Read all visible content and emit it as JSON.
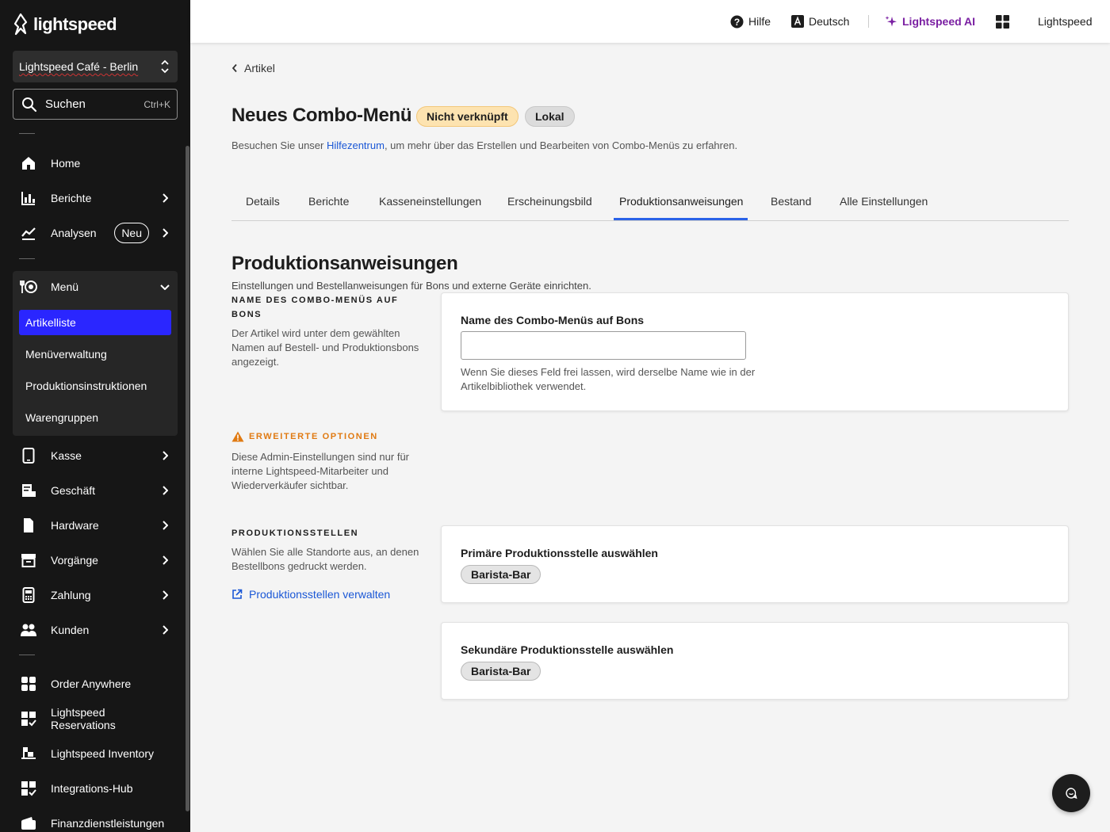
{
  "sidebar": {
    "brand": "lightspeed",
    "store": "Lightspeed Café - Berlin",
    "search": {
      "label": "Suchen",
      "shortcut": "Ctrl+K"
    },
    "nav": {
      "home": "Home",
      "berichte": "Berichte",
      "analysen": "Analysen",
      "analysen_badge": "Neu",
      "menu": "Menü",
      "kasse": "Kasse",
      "geschaeft": "Geschäft",
      "hardware": "Hardware",
      "vorgaenge": "Vorgänge",
      "zahlung": "Zahlung",
      "kunden": "Kunden",
      "order_anywhere": "Order Anywhere",
      "reservations": "Lightspeed Reservations",
      "inventory": "Lightspeed Inventory",
      "integrations": "Integrations-Hub",
      "finanz": "Finanzdienstleistungen"
    },
    "menu_sub": {
      "artikelliste": "Artikelliste",
      "menueverwaltung": "Menüverwaltung",
      "produktionsinstruktionen": "Produktionsinstruktionen",
      "warengruppen": "Warengruppen"
    },
    "active_color": "#2a26ff"
  },
  "topbar": {
    "help": "Hilfe",
    "language": "Deutsch",
    "ai": "Lightspeed AI",
    "ai_color": "#7a1fa2",
    "account": "Lightspeed"
  },
  "page": {
    "back": "Artikel",
    "title": "Neues Combo-Menü",
    "badge_warn": "Nicht verknüpft",
    "badge_local": "Lokal",
    "help_prefix": "Besuchen Sie unser ",
    "help_link": "Hilfezentrum",
    "help_suffix": ", um mehr über das Erstellen und Bearbeiten von Combo-Menüs zu erfahren."
  },
  "tabs": {
    "details": "Details",
    "berichte": "Berichte",
    "kasse": "Kasseneinstellungen",
    "erscheinung": "Erscheinungsbild",
    "produktion": "Produktionsanweisungen",
    "bestand": "Bestand",
    "alle": "Alle Einstellungen"
  },
  "section": {
    "title": "Produktionsanweisungen",
    "description": "Einstellungen und Bestellanweisungen für Bons und externe Geräte einrichten.",
    "name_label": "NAME DES COMBO-MENÜS AUF BONS",
    "name_text": "Der Artikel wird unter dem gewählten Namen auf Bestell- und Produktionsbons angezeigt.",
    "name_field_title": "Name des Combo-Menüs auf Bons",
    "name_field_value": "",
    "name_field_hint": "Wenn Sie dieses Feld frei lassen, wird derselbe Name wie in der Artikelbibliothek verwendet.",
    "adv_label": "ERWEITERTE OPTIONEN",
    "adv_text": "Diese Admin-Einstellungen sind nur für interne Lightspeed-Mitarbeiter und Wiederverkäufer sichtbar.",
    "stations_label": "PRODUKTIONSSTELLEN",
    "stations_text": "Wählen Sie alle Standorte aus, an denen Bestellbons gedruckt werden.",
    "stations_link": "Produktionsstellen verwalten",
    "primary_title": "Primäre Produktionsstelle auswählen",
    "primary_value": "Barista-Bar",
    "secondary_title": "Sekundäre Produktionsstelle auswählen",
    "secondary_value": "Barista-Bar"
  }
}
